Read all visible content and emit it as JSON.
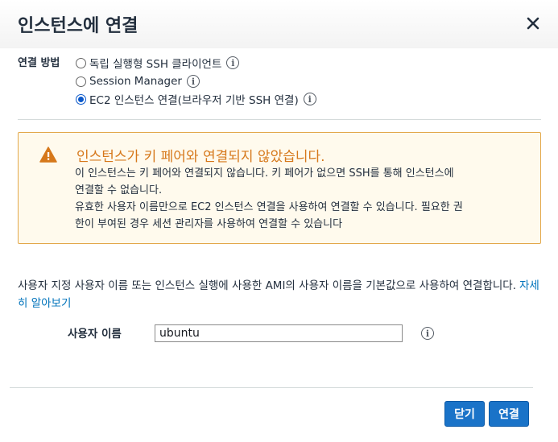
{
  "dialog": {
    "title": "인스턴스에 연결"
  },
  "method": {
    "label": "연결 방법",
    "options": [
      {
        "label": "독립 실행형 SSH 클라이언트",
        "selected": false
      },
      {
        "label": "Session Manager",
        "selected": false
      },
      {
        "label": "EC2 인스턴스 연결(브라우저 기반 SSH 연결)",
        "selected": true
      }
    ]
  },
  "alert": {
    "title": "인스턴스가 키 페어와 연결되지 않았습니다.",
    "line1": "이 인스턴스는 키 페어와 연결되지 않습니다. 키 페어가 없으면 SSH를 통해 인스턴스에",
    "line2": "연결할 수 없습니다.",
    "line3": "유효한 사용자 이름만으로 EC2 인스턴스 연결을 사용하여 연결할 수 있습니다. 필요한 권",
    "line4": "한이 부여된 경우 세션 관리자를 사용하여 연결할 수 있습니다"
  },
  "description": {
    "text": "사용자 지정 사용자 이름 또는 인스턴스 실행에 사용한 AMI의 사용자 이름을 기본값으로 사용하여 연결합니다.",
    "learn_more": "자세히 알아보기"
  },
  "username": {
    "label": "사용자 이름",
    "value": "ubuntu"
  },
  "buttons": {
    "close": "닫기",
    "connect": "연결"
  },
  "colors": {
    "primary": "#1a73c8",
    "warning": "#d6781b",
    "link": "#0073bb"
  }
}
